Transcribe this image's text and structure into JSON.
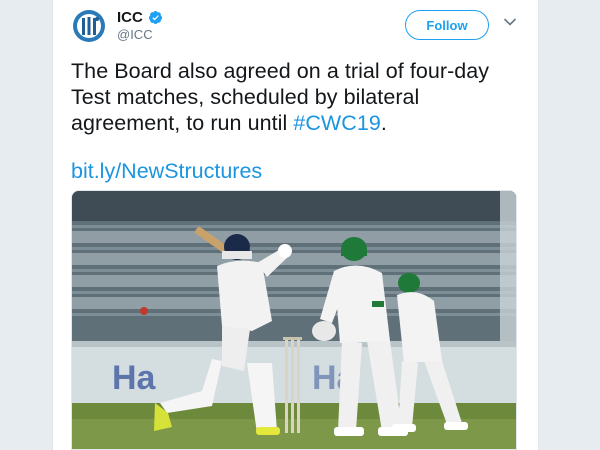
{
  "account": {
    "name": "ICC",
    "handle": "@ICC",
    "avatar_icon": "icc-logo-icon",
    "verified_icon": "verified-badge-icon"
  },
  "follow_label": "Follow",
  "tweet": {
    "text_before": "The Board also agreed on a trial of four-day Test matches, scheduled by bilateral agreement, to run until ",
    "hashtag": "#CWC19",
    "text_after": ".",
    "link": "bit.ly/NewStructures"
  },
  "photo": {
    "signage": "Ha"
  },
  "colors": {
    "twitter_blue": "#1da1f2",
    "link_blue": "#1b95e0",
    "text": "#14171a",
    "muted": "#657786",
    "pakistan_green": "#1f7a3a"
  }
}
